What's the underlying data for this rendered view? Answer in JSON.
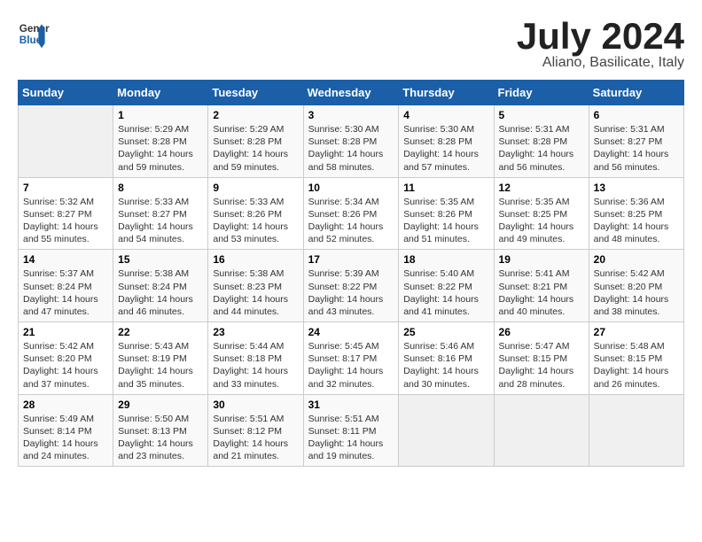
{
  "logo": {
    "line1": "General",
    "line2": "Blue"
  },
  "title": "July 2024",
  "subtitle": "Aliano, Basilicate, Italy",
  "days_header": [
    "Sunday",
    "Monday",
    "Tuesday",
    "Wednesday",
    "Thursday",
    "Friday",
    "Saturday"
  ],
  "weeks": [
    [
      {
        "num": "",
        "info": ""
      },
      {
        "num": "1",
        "info": "Sunrise: 5:29 AM\nSunset: 8:28 PM\nDaylight: 14 hours\nand 59 minutes."
      },
      {
        "num": "2",
        "info": "Sunrise: 5:29 AM\nSunset: 8:28 PM\nDaylight: 14 hours\nand 59 minutes."
      },
      {
        "num": "3",
        "info": "Sunrise: 5:30 AM\nSunset: 8:28 PM\nDaylight: 14 hours\nand 58 minutes."
      },
      {
        "num": "4",
        "info": "Sunrise: 5:30 AM\nSunset: 8:28 PM\nDaylight: 14 hours\nand 57 minutes."
      },
      {
        "num": "5",
        "info": "Sunrise: 5:31 AM\nSunset: 8:28 PM\nDaylight: 14 hours\nand 56 minutes."
      },
      {
        "num": "6",
        "info": "Sunrise: 5:31 AM\nSunset: 8:27 PM\nDaylight: 14 hours\nand 56 minutes."
      }
    ],
    [
      {
        "num": "7",
        "info": "Sunrise: 5:32 AM\nSunset: 8:27 PM\nDaylight: 14 hours\nand 55 minutes."
      },
      {
        "num": "8",
        "info": "Sunrise: 5:33 AM\nSunset: 8:27 PM\nDaylight: 14 hours\nand 54 minutes."
      },
      {
        "num": "9",
        "info": "Sunrise: 5:33 AM\nSunset: 8:26 PM\nDaylight: 14 hours\nand 53 minutes."
      },
      {
        "num": "10",
        "info": "Sunrise: 5:34 AM\nSunset: 8:26 PM\nDaylight: 14 hours\nand 52 minutes."
      },
      {
        "num": "11",
        "info": "Sunrise: 5:35 AM\nSunset: 8:26 PM\nDaylight: 14 hours\nand 51 minutes."
      },
      {
        "num": "12",
        "info": "Sunrise: 5:35 AM\nSunset: 8:25 PM\nDaylight: 14 hours\nand 49 minutes."
      },
      {
        "num": "13",
        "info": "Sunrise: 5:36 AM\nSunset: 8:25 PM\nDaylight: 14 hours\nand 48 minutes."
      }
    ],
    [
      {
        "num": "14",
        "info": "Sunrise: 5:37 AM\nSunset: 8:24 PM\nDaylight: 14 hours\nand 47 minutes."
      },
      {
        "num": "15",
        "info": "Sunrise: 5:38 AM\nSunset: 8:24 PM\nDaylight: 14 hours\nand 46 minutes."
      },
      {
        "num": "16",
        "info": "Sunrise: 5:38 AM\nSunset: 8:23 PM\nDaylight: 14 hours\nand 44 minutes."
      },
      {
        "num": "17",
        "info": "Sunrise: 5:39 AM\nSunset: 8:22 PM\nDaylight: 14 hours\nand 43 minutes."
      },
      {
        "num": "18",
        "info": "Sunrise: 5:40 AM\nSunset: 8:22 PM\nDaylight: 14 hours\nand 41 minutes."
      },
      {
        "num": "19",
        "info": "Sunrise: 5:41 AM\nSunset: 8:21 PM\nDaylight: 14 hours\nand 40 minutes."
      },
      {
        "num": "20",
        "info": "Sunrise: 5:42 AM\nSunset: 8:20 PM\nDaylight: 14 hours\nand 38 minutes."
      }
    ],
    [
      {
        "num": "21",
        "info": "Sunrise: 5:42 AM\nSunset: 8:20 PM\nDaylight: 14 hours\nand 37 minutes."
      },
      {
        "num": "22",
        "info": "Sunrise: 5:43 AM\nSunset: 8:19 PM\nDaylight: 14 hours\nand 35 minutes."
      },
      {
        "num": "23",
        "info": "Sunrise: 5:44 AM\nSunset: 8:18 PM\nDaylight: 14 hours\nand 33 minutes."
      },
      {
        "num": "24",
        "info": "Sunrise: 5:45 AM\nSunset: 8:17 PM\nDaylight: 14 hours\nand 32 minutes."
      },
      {
        "num": "25",
        "info": "Sunrise: 5:46 AM\nSunset: 8:16 PM\nDaylight: 14 hours\nand 30 minutes."
      },
      {
        "num": "26",
        "info": "Sunrise: 5:47 AM\nSunset: 8:15 PM\nDaylight: 14 hours\nand 28 minutes."
      },
      {
        "num": "27",
        "info": "Sunrise: 5:48 AM\nSunset: 8:15 PM\nDaylight: 14 hours\nand 26 minutes."
      }
    ],
    [
      {
        "num": "28",
        "info": "Sunrise: 5:49 AM\nSunset: 8:14 PM\nDaylight: 14 hours\nand 24 minutes."
      },
      {
        "num": "29",
        "info": "Sunrise: 5:50 AM\nSunset: 8:13 PM\nDaylight: 14 hours\nand 23 minutes."
      },
      {
        "num": "30",
        "info": "Sunrise: 5:51 AM\nSunset: 8:12 PM\nDaylight: 14 hours\nand 21 minutes."
      },
      {
        "num": "31",
        "info": "Sunrise: 5:51 AM\nSunset: 8:11 PM\nDaylight: 14 hours\nand 19 minutes."
      },
      {
        "num": "",
        "info": ""
      },
      {
        "num": "",
        "info": ""
      },
      {
        "num": "",
        "info": ""
      }
    ]
  ]
}
